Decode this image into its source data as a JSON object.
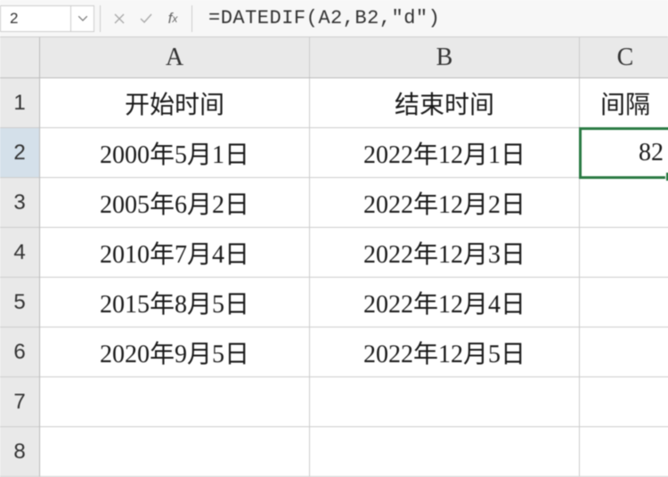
{
  "formula_bar": {
    "cell_ref": "2",
    "formula": "=DATEDIF(A2,B2,\"d\")"
  },
  "columns": {
    "A": "A",
    "B": "B",
    "C": "C"
  },
  "rows": [
    "1",
    "2",
    "3",
    "4",
    "5",
    "6",
    "7",
    "8"
  ],
  "headers": {
    "A": "开始时间",
    "B": "结束时间",
    "C": "间隔"
  },
  "data": [
    {
      "A": "2000年5月1日",
      "B": "2022年12月1日",
      "C": "82"
    },
    {
      "A": "2005年6月2日",
      "B": "2022年12月2日",
      "C": ""
    },
    {
      "A": "2010年7月4日",
      "B": "2022年12月3日",
      "C": ""
    },
    {
      "A": "2015年8月5日",
      "B": "2022年12月4日",
      "C": ""
    },
    {
      "A": "2020年9月5日",
      "B": "2022年12月5日",
      "C": ""
    }
  ],
  "chart_data": {
    "type": "table",
    "columns": [
      "开始时间",
      "结束时间",
      "间隔"
    ],
    "rows": [
      [
        "2000年5月1日",
        "2022年12月1日",
        82
      ],
      [
        "2005年6月2日",
        "2022年12月2日",
        null
      ],
      [
        "2010年7月4日",
        "2022年12月3日",
        null
      ],
      [
        "2015年8月5日",
        "2022年12月4日",
        null
      ],
      [
        "2020年9月5日",
        "2022年12月5日",
        null
      ]
    ]
  }
}
